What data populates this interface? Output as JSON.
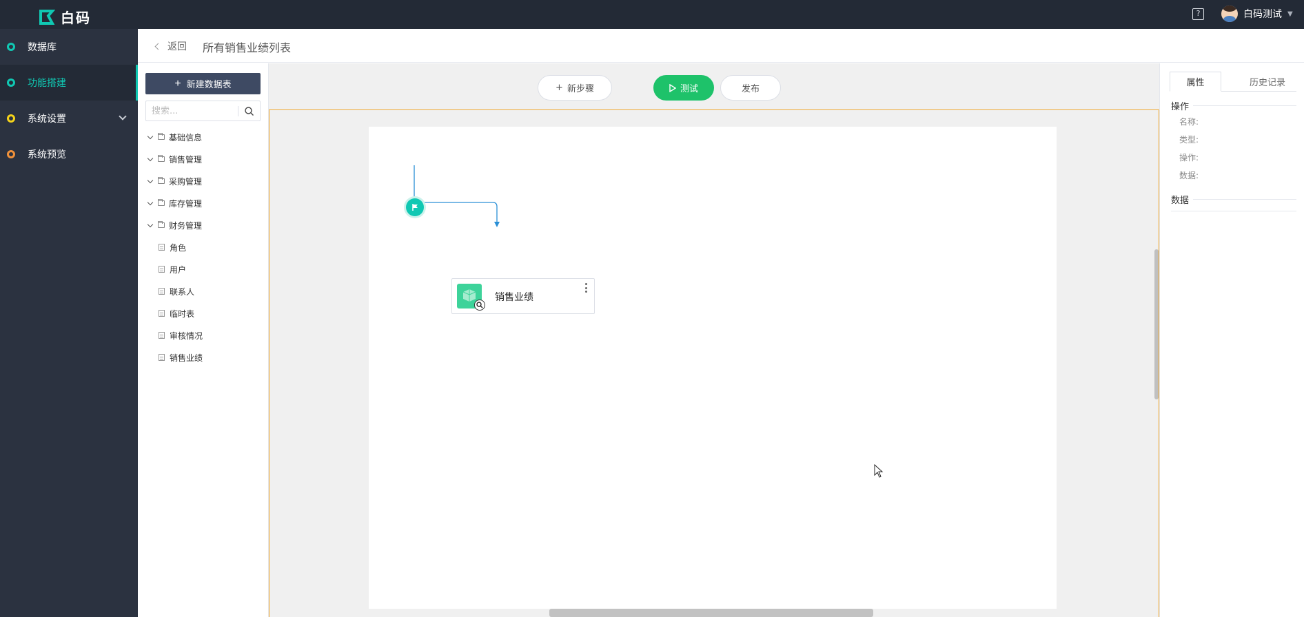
{
  "app": {
    "logo_text": "白码",
    "brand_color": "#10c8b3",
    "topbar_color": "#232a36"
  },
  "topbar": {
    "help_icon": "?",
    "user_name": "白码测试"
  },
  "nav": {
    "items": [
      {
        "label": "数据库",
        "dot_color": "#10c8b3",
        "active": false
      },
      {
        "label": "功能搭建",
        "dot_color": "#10c8b3",
        "active": true
      },
      {
        "label": "系统设置",
        "dot_color": "#f5d31a",
        "active": false,
        "expandable": true
      },
      {
        "label": "系统预览",
        "dot_color": "#f0913a",
        "active": false
      }
    ]
  },
  "header": {
    "back_label": "返回",
    "title": "所有销售业绩列表"
  },
  "tables_panel": {
    "new_table_label": "新建数据表",
    "search_placeholder": "搜索...",
    "folders": [
      {
        "label": "基础信息"
      },
      {
        "label": "销售管理"
      },
      {
        "label": "采购管理"
      },
      {
        "label": "库存管理"
      },
      {
        "label": "财务管理"
      }
    ],
    "tables": [
      {
        "label": "角色"
      },
      {
        "label": "用户"
      },
      {
        "label": "联系人"
      },
      {
        "label": "临时表"
      },
      {
        "label": "审核情况"
      },
      {
        "label": "销售业绩"
      }
    ]
  },
  "toolbar": {
    "new_step_label": "新步骤",
    "test_label": "测试",
    "publish_label": "发布",
    "test_color": "#1ec26a"
  },
  "flow": {
    "node_label": "销售业绩",
    "node_color": "#3dd39a"
  },
  "props_panel": {
    "tabs": [
      {
        "label": "属性",
        "active": true
      },
      {
        "label": "历史记录",
        "active": false
      }
    ],
    "operation_section": "操作",
    "fields": [
      {
        "label": "名称:"
      },
      {
        "label": "类型:"
      },
      {
        "label": "操作:"
      },
      {
        "label": "数据:"
      }
    ],
    "data_section": "数据"
  }
}
